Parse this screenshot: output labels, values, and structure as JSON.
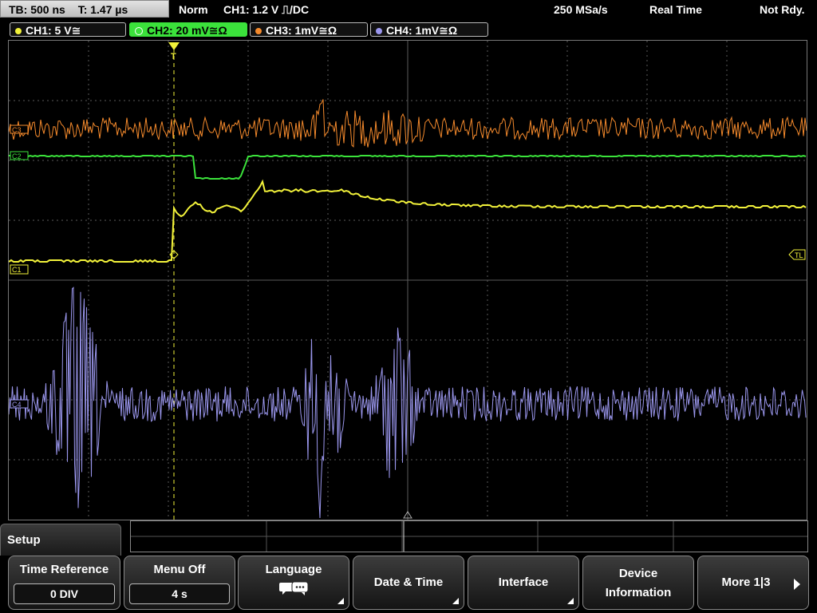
{
  "top_bar": {
    "timebase": "TB: 500 ns",
    "trigger_time": "T: 1.47 µs",
    "trigger_mode": "Norm",
    "trigger_setting": "CH1: 1.2 V ⎍/DC",
    "sample_rate": "250 MSa/s",
    "acq_mode": "Real Time",
    "status": "Not Rdy."
  },
  "channels": [
    {
      "label": "CH1: 5 V≅",
      "color": "#f2f23a",
      "active": false
    },
    {
      "label": "CH2: 20 mV≅Ω",
      "color": "#3be23b",
      "active": true
    },
    {
      "label": "CH3: 1mV≅Ω",
      "color": "#f58a2c",
      "active": false
    },
    {
      "label": "CH4: 1mV≅Ω",
      "color": "#9b97ee",
      "active": false
    }
  ],
  "markers": {
    "ch1": "C1",
    "ch2": "C2",
    "ch3": "C3",
    "ch4": "C4",
    "trigger_level": "TL",
    "trigger_point": "T"
  },
  "menu": {
    "title": "Setup",
    "softkeys": [
      {
        "label": "Time Reference",
        "value": "0 DIV"
      },
      {
        "label": "Menu Off",
        "value": "4 s"
      },
      {
        "label": "Language",
        "icon": "speech-bubbles-icon"
      },
      {
        "label": "Date & Time"
      },
      {
        "label": "Interface"
      },
      {
        "label": "Device\nInformation",
        "line1": "Device",
        "line2": "Information"
      },
      {
        "label": "More 1|3"
      }
    ]
  },
  "colors": {
    "ch1": "#f2f23a",
    "ch2": "#3be23b",
    "ch3": "#f58a2c",
    "ch4": "#9b97ee",
    "grid": "#5a5a5a",
    "trigger_line": "#f2f23a"
  }
}
